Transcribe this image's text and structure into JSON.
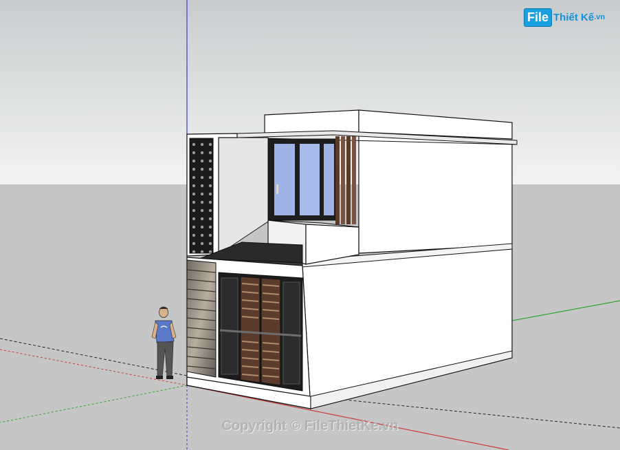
{
  "watermark": {
    "logo_part1": "File",
    "logo_part2": "Thiết Kế",
    "logo_part3": ".vn",
    "copyright": "Copyright © FileThietKe.vn"
  },
  "colors": {
    "sky_top": "#c9cccd",
    "sky_bottom": "#f2f2f2",
    "ground": "#c6c6c6",
    "axis_blue": "#3b3bcc",
    "axis_green": "#2ea52e",
    "axis_red": "#cc3b3b",
    "wall": "#ffffff",
    "wall_shade": "#ececec",
    "glass": "#9fb3e6",
    "wood": "#6e4a35",
    "stone": "#8c8478",
    "dark": "#1e1e1e"
  }
}
